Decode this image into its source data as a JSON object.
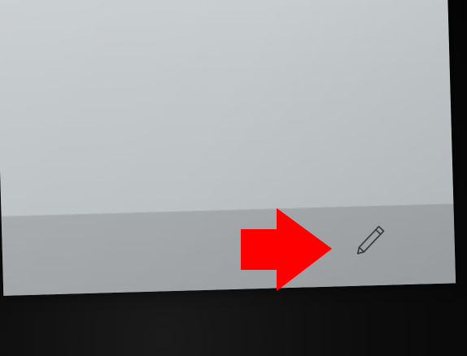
{
  "screen": {
    "content_background": "#c5cacc",
    "bottom_bar_background": "#a3a7a9"
  },
  "toolbar": {
    "edit_icon": "pencil-icon",
    "icon_color": "#3a3d3f"
  },
  "annotation": {
    "arrow_icon": "right-arrow-icon",
    "arrow_color": "#ff0000"
  }
}
